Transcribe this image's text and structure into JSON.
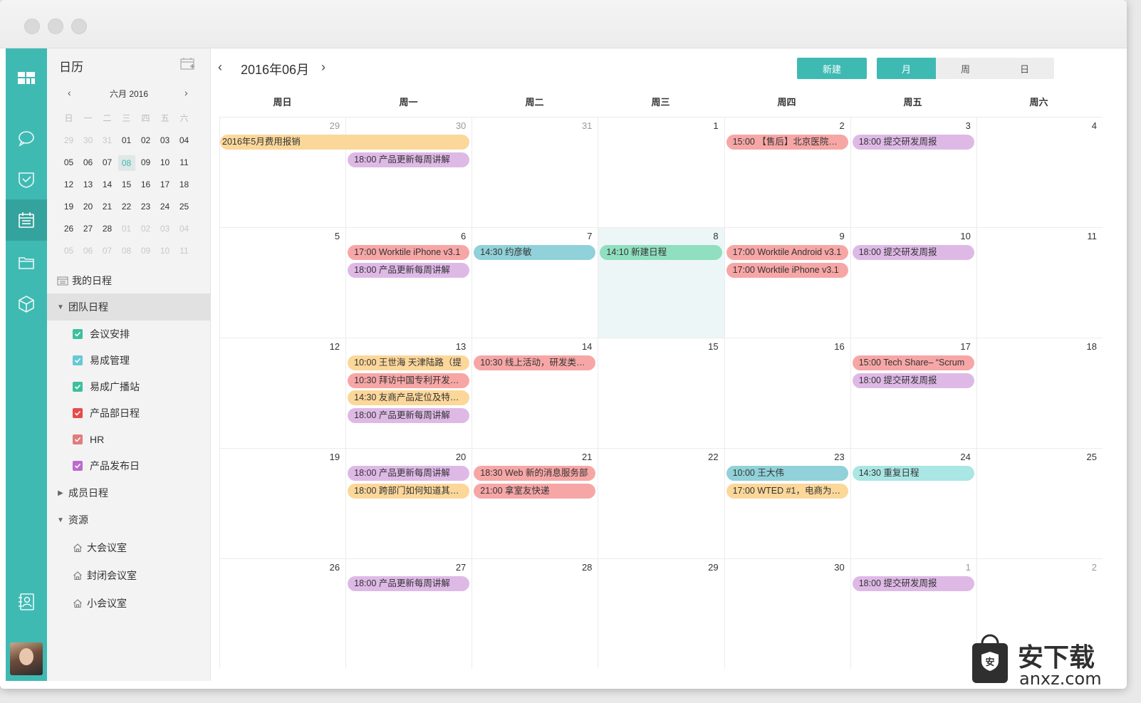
{
  "sidebar": {
    "title": "日历",
    "mini_calendar": {
      "label": "六月 2016",
      "prev": "‹",
      "next": "›",
      "weekdays": [
        "日",
        "一",
        "二",
        "三",
        "四",
        "五",
        "六"
      ],
      "days": [
        "29",
        "30",
        "31",
        "01",
        "02",
        "03",
        "04",
        "05",
        "06",
        "07",
        "08",
        "09",
        "10",
        "11",
        "12",
        "13",
        "14",
        "15",
        "16",
        "17",
        "18",
        "19",
        "20",
        "21",
        "22",
        "23",
        "24",
        "25",
        "26",
        "27",
        "28",
        "01",
        "02",
        "03",
        "04",
        "05",
        "06",
        "07",
        "08",
        "09",
        "10",
        "11"
      ]
    },
    "my_schedule": "我的日程",
    "team_schedule": "团队日程",
    "team_calendars": [
      {
        "label": "会议安排",
        "color": "#3dbf9f"
      },
      {
        "label": "易成管理",
        "color": "#67c8d6"
      },
      {
        "label": "易成广播站",
        "color": "#3dbf9f"
      },
      {
        "label": "产品部日程",
        "color": "#e64b4b"
      },
      {
        "label": "HR",
        "color": "#e07d7d"
      },
      {
        "label": "产品发布日",
        "color": "#bb6bd0"
      }
    ],
    "member_schedule": "成员日程",
    "resources": "资源",
    "rooms": [
      "大会议室",
      "封闭会议室",
      "小会议室"
    ]
  },
  "header": {
    "prev": "‹",
    "next": "›",
    "title": "2016年06月",
    "new_button": "新建",
    "views": [
      "月",
      "周",
      "日"
    ]
  },
  "weekdays": [
    "周日",
    "周一",
    "周二",
    "周三",
    "周四",
    "周五",
    "周六"
  ],
  "weeks": [
    {
      "days": [
        "29",
        "30",
        "31",
        "1",
        "2",
        "3",
        "4"
      ],
      "dim": [
        true,
        true,
        true,
        false,
        false,
        false,
        false
      ]
    },
    {
      "days": [
        "5",
        "6",
        "7",
        "8",
        "9",
        "10",
        "11"
      ],
      "dim": [
        false,
        false,
        false,
        false,
        false,
        false,
        false
      ]
    },
    {
      "days": [
        "12",
        "13",
        "14",
        "15",
        "16",
        "17",
        "18"
      ],
      "dim": [
        false,
        false,
        false,
        false,
        false,
        false,
        false
      ]
    },
    {
      "days": [
        "19",
        "20",
        "21",
        "22",
        "23",
        "24",
        "25"
      ],
      "dim": [
        false,
        false,
        false,
        false,
        false,
        false,
        false
      ]
    },
    {
      "days": [
        "26",
        "27",
        "28",
        "29",
        "30",
        "1",
        "2"
      ],
      "dim": [
        false,
        false,
        false,
        false,
        false,
        true,
        true
      ]
    }
  ],
  "events": [
    {
      "week": 0,
      "col": 0,
      "span": 2,
      "slot": 0,
      "color": "orange",
      "text": "2016年5月费用报销"
    },
    {
      "week": 0,
      "col": 1,
      "span": 1,
      "slot": 1,
      "color": "purple",
      "text": "18:00 产品更新每周讲解"
    },
    {
      "week": 0,
      "col": 4,
      "span": 1,
      "slot": 0,
      "color": "red",
      "text": "15:00 【售后】北京医院上..."
    },
    {
      "week": 0,
      "col": 5,
      "span": 1,
      "slot": 0,
      "color": "purple",
      "text": "18:00 提交研发周报"
    },
    {
      "week": 1,
      "col": 1,
      "span": 1,
      "slot": 0,
      "color": "red",
      "text": "17:00 Worktile iPhone v3.1"
    },
    {
      "week": 1,
      "col": 1,
      "span": 1,
      "slot": 1,
      "color": "purple",
      "text": "18:00 产品更新每周讲解"
    },
    {
      "week": 1,
      "col": 2,
      "span": 1,
      "slot": 0,
      "color": "blue",
      "text": "14:30 约彦敏"
    },
    {
      "week": 1,
      "col": 3,
      "span": 1,
      "slot": 0,
      "color": "green",
      "text": "14:10 新建日程"
    },
    {
      "week": 1,
      "col": 4,
      "span": 1,
      "slot": 0,
      "color": "red",
      "text": "17:00 Worktile Android v3.1"
    },
    {
      "week": 1,
      "col": 4,
      "span": 1,
      "slot": 1,
      "color": "red",
      "text": "17:00 Worktile iPhone v3.1"
    },
    {
      "week": 1,
      "col": 5,
      "span": 1,
      "slot": 0,
      "color": "purple",
      "text": "18:00 提交研发周报"
    },
    {
      "week": 2,
      "col": 1,
      "span": 1,
      "slot": 0,
      "color": "orange",
      "text": "10:00 王世海 天津陆路（提"
    },
    {
      "week": 2,
      "col": 1,
      "span": 1,
      "slot": 1,
      "color": "red",
      "text": "10:30 拜访中国专利开发公..."
    },
    {
      "week": 2,
      "col": 1,
      "span": 1,
      "slot": 2,
      "color": "orange",
      "text": "14:30 友商产品定位及特性..."
    },
    {
      "week": 2,
      "col": 1,
      "span": 1,
      "slot": 3,
      "color": "purple",
      "text": "18:00 产品更新每周讲解"
    },
    {
      "week": 2,
      "col": 2,
      "span": 1,
      "slot": 0,
      "color": "red",
      "text": "10:30 线上活动，研发类客..."
    },
    {
      "week": 2,
      "col": 5,
      "span": 1,
      "slot": 0,
      "color": "red",
      "text": "15:00 Tech Share– “Scrum"
    },
    {
      "week": 2,
      "col": 5,
      "span": 1,
      "slot": 1,
      "color": "purple",
      "text": "18:00 提交研发周报"
    },
    {
      "week": 3,
      "col": 1,
      "span": 1,
      "slot": 0,
      "color": "purple",
      "text": "18:00 产品更新每周讲解"
    },
    {
      "week": 3,
      "col": 1,
      "span": 1,
      "slot": 1,
      "color": "orange",
      "text": "18:00 跨部门如何知道其他..."
    },
    {
      "week": 3,
      "col": 2,
      "span": 1,
      "slot": 0,
      "color": "red",
      "text": "18:30 Web 新的消息服务部"
    },
    {
      "week": 3,
      "col": 2,
      "span": 1,
      "slot": 1,
      "color": "red",
      "text": "21:00 拿室友快递"
    },
    {
      "week": 3,
      "col": 4,
      "span": 1,
      "slot": 0,
      "color": "blue",
      "text": "10:00 王大伟"
    },
    {
      "week": 3,
      "col": 4,
      "span": 1,
      "slot": 1,
      "color": "orange",
      "text": "17:00 WTED #1，电商为什..."
    },
    {
      "week": 3,
      "col": 5,
      "span": 1,
      "slot": 0,
      "color": "teal",
      "text": "14:30 重复日程"
    },
    {
      "week": 4,
      "col": 1,
      "span": 1,
      "slot": 0,
      "color": "purple",
      "text": "18:00 产品更新每周讲解"
    },
    {
      "week": 4,
      "col": 5,
      "span": 1,
      "slot": 0,
      "color": "purple",
      "text": "18:00 提交研发周报"
    }
  ],
  "today": {
    "week": 1,
    "col": 3
  },
  "watermark": {
    "label": "安下载",
    "url": "anxz.com"
  }
}
